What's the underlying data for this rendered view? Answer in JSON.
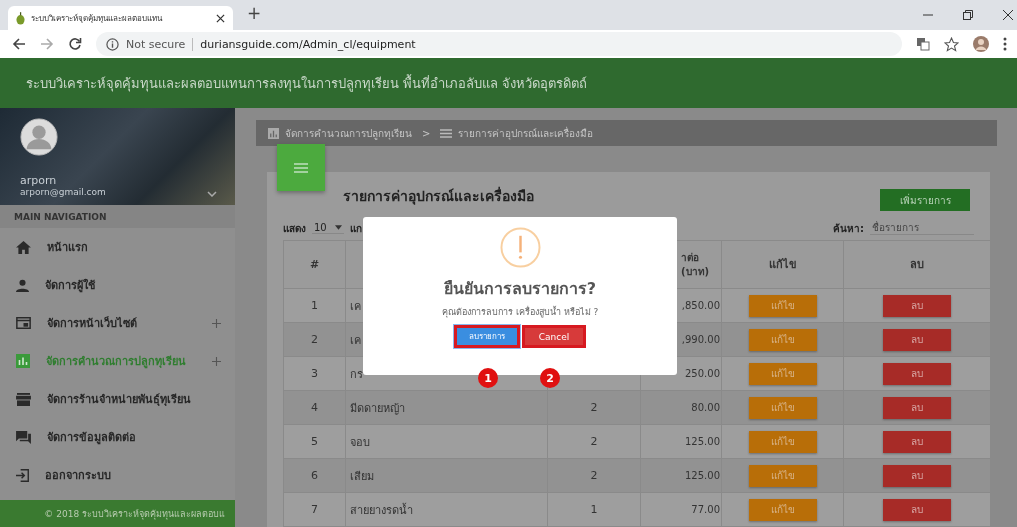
{
  "browser": {
    "tab_title": "ระบบวิเคราะห์จุดคุ้มทุนและผลตอบแทน",
    "new_tab": "+",
    "security": "Not secure",
    "url": "duriansguide.com/Admin_cl/equipment"
  },
  "header": {
    "title": "ระบบวิเคราะห์จุดคุ้มทุนและผลตอบแทนการลงทุนในการปลูกทุเรียน พื้นที่อำเภอลับแล จังหวัดอุตรดิตถ์"
  },
  "sidebar": {
    "user_name": "arporn",
    "user_email": "arporn@gmail.com",
    "section_label": "MAIN NAVIGATION",
    "items": [
      {
        "label": "หน้าแรก",
        "expandable": false,
        "selected": false
      },
      {
        "label": "จัดการผู้ใช้",
        "expandable": false,
        "selected": false
      },
      {
        "label": "จัดการหน้าเว็บไซต์",
        "expandable": true,
        "selected": false
      },
      {
        "label": "จัดการคำนวณการปลูกทุเรียน",
        "expandable": true,
        "selected": true
      },
      {
        "label": "จัดการร้านจำหน่ายพันธุ์ทุเรียน",
        "expandable": false,
        "selected": false
      },
      {
        "label": "จัดการข้อมูลติดต่อ",
        "expandable": false,
        "selected": false
      },
      {
        "label": "ออกจากระบบ",
        "expandable": false,
        "selected": false
      }
    ],
    "footer": "© 2018 ระบบวิเคราะห์จุดคุ้มทุนและผลตอบแ"
  },
  "breadcrumb": [
    {
      "label": "จัดการคำนวณการปลูกทุเรียน"
    },
    {
      "label": "รายการค่าอุปกรณ์และเครื่องมือ"
    }
  ],
  "breadcrumb_separator": ">",
  "card": {
    "title": "รายการค่าอุปกรณ์และเครื่องมือ",
    "add_button": "เพิ่มรายการ",
    "show_label": "แสดง",
    "page_size": "10",
    "show_after": "แก",
    "search_label": "ค้นหา:",
    "search_placeholder": "ชื่อรายการ"
  },
  "table": {
    "columns": [
      "#",
      "",
      "",
      "าต่อ\n(บาท)",
      "แก้ไข",
      "ลบ"
    ],
    "rows": [
      {
        "no": "1",
        "name": "เค",
        "quantity": "",
        "price": ",850.00",
        "edit": "แก้ไข",
        "delete": "ลบ"
      },
      {
        "no": "2",
        "name": "เค",
        "quantity": "",
        "price": ",990.00",
        "edit": "แก้ไข",
        "delete": "ลบ"
      },
      {
        "no": "3",
        "name": "กร",
        "quantity": "",
        "price": "250.00",
        "edit": "แก้ไข",
        "delete": "ลบ"
      },
      {
        "no": "4",
        "name": "มีดดายหญ้า",
        "quantity": "2",
        "price": "80.00",
        "edit": "แก้ไข",
        "delete": "ลบ"
      },
      {
        "no": "5",
        "name": "จอบ",
        "quantity": "2",
        "price": "125.00",
        "edit": "แก้ไข",
        "delete": "ลบ"
      },
      {
        "no": "6",
        "name": "เสียม",
        "quantity": "2",
        "price": "125.00",
        "edit": "แก้ไข",
        "delete": "ลบ"
      },
      {
        "no": "7",
        "name": "สายยางรดน้ำ",
        "quantity": "1",
        "price": "77.00",
        "edit": "แก้ไข",
        "delete": "ลบ"
      }
    ]
  },
  "dialog": {
    "title": "ยืนยันการลบรายการ?",
    "message": "คุณต้องการลบการ เครื่องสูบน้ำ หรือไม่ ?",
    "confirm": "ลบรายการ",
    "cancel": "Cancel"
  },
  "callouts": [
    "1",
    "2"
  ]
}
